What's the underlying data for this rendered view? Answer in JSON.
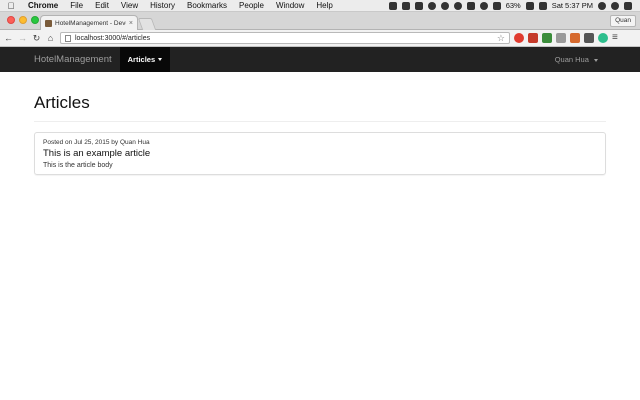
{
  "menubar": {
    "apple_icon": "apple-logo",
    "items": [
      "Chrome",
      "File",
      "Edit",
      "View",
      "History",
      "Bookmarks",
      "People",
      "Window",
      "Help"
    ],
    "battery": "63%",
    "clock": "Sat 5:37 PM"
  },
  "browser": {
    "tab_title": "HotelManagement - Devel...",
    "profile_name": "Quan",
    "url": "localhost:3000/#/articles"
  },
  "navbar": {
    "brand": "HotelManagement",
    "active_item": "Articles",
    "user": "Quan Hua"
  },
  "page": {
    "title": "Articles",
    "articles": [
      {
        "meta": "Posted on Jul 25, 2015 by Quan Hua",
        "title": "This is an example article",
        "body": "This is the article body"
      }
    ]
  },
  "colors": {
    "navbar_bg": "#222222",
    "navbar_active_bg": "#080808",
    "navbar_text": "#9d9d9d"
  }
}
